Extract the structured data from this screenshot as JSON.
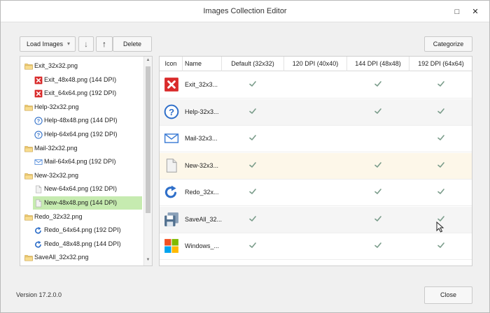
{
  "window": {
    "title": "Images Collection Editor",
    "maximize_glyph": "□",
    "close_glyph": "✕"
  },
  "toolbar": {
    "load_label": "Load Images",
    "load_arrow": "▾",
    "down_glyph": "↓",
    "up_glyph": "↑",
    "delete_label": "Delete",
    "categorize_label": "Categorize"
  },
  "tree": {
    "items": [
      {
        "label": "Exit_32x32.png",
        "level": 0,
        "icon": "folder-icon"
      },
      {
        "label": "Exit_48x48.png (144 DPI)",
        "level": 1,
        "icon": "exit-icon"
      },
      {
        "label": "Exit_64x64.png (192 DPI)",
        "level": 1,
        "icon": "exit-icon"
      },
      {
        "label": "Help-32x32.png",
        "level": 0,
        "icon": "folder-icon"
      },
      {
        "label": "Help-48x48.png (144 DPI)",
        "level": 1,
        "icon": "help-icon"
      },
      {
        "label": "Help-64x64.png (192 DPI)",
        "level": 1,
        "icon": "help-icon"
      },
      {
        "label": "Mail-32x32.png",
        "level": 0,
        "icon": "folder-icon"
      },
      {
        "label": "Mail-64x64.png (192 DPI)",
        "level": 1,
        "icon": "mail-icon"
      },
      {
        "label": "New-32x32.png",
        "level": 0,
        "icon": "folder-icon"
      },
      {
        "label": "New-64x64.png (192 DPI)",
        "level": 1,
        "icon": "new-icon"
      },
      {
        "label": "New-48x48.png (144 DPI)",
        "level": 1,
        "icon": "new-icon",
        "selected": true
      },
      {
        "label": "Redo_32x32.png",
        "level": 0,
        "icon": "folder-icon"
      },
      {
        "label": "Redo_64x64.png (192 DPI)",
        "level": 1,
        "icon": "redo-icon"
      },
      {
        "label": "Redo_48x48.png (144 DPI)",
        "level": 1,
        "icon": "redo-icon"
      },
      {
        "label": "SaveAll_32x32.png",
        "level": 0,
        "icon": "folder-icon"
      }
    ]
  },
  "grid": {
    "columns": [
      "Icon",
      "Name",
      "Default (32x32)",
      "120 DPI (40x40)",
      "144 DPI (48x48)",
      "192 DPI (64x64)"
    ],
    "rows": [
      {
        "name": "Exit_32x3...",
        "icon": "exit-icon",
        "checks": [
          true,
          false,
          true,
          true
        ]
      },
      {
        "name": "Help-32x3...",
        "icon": "help-icon",
        "checks": [
          true,
          false,
          true,
          true
        ]
      },
      {
        "name": "Mail-32x3...",
        "icon": "mail-icon",
        "checks": [
          true,
          false,
          false,
          true
        ]
      },
      {
        "name": "New-32x3...",
        "icon": "new-icon",
        "checks": [
          true,
          false,
          true,
          true
        ]
      },
      {
        "name": "Redo_32x...",
        "icon": "redo-icon",
        "checks": [
          true,
          false,
          true,
          true
        ]
      },
      {
        "name": "SaveAll_32...",
        "icon": "saveall-icon",
        "checks": [
          true,
          false,
          true,
          true
        ]
      },
      {
        "name": "Windows_...",
        "icon": "windows-icon",
        "checks": [
          true,
          false,
          true,
          true
        ]
      }
    ]
  },
  "footer": {
    "version": "Version 17.2.0.0",
    "close_label": "Close"
  },
  "colors": {
    "check": "#7a9c8a",
    "exit": "#d92b2b",
    "help": "#2f6fc9",
    "selection": "#c6ebb0",
    "folder": "#f4d27a"
  }
}
